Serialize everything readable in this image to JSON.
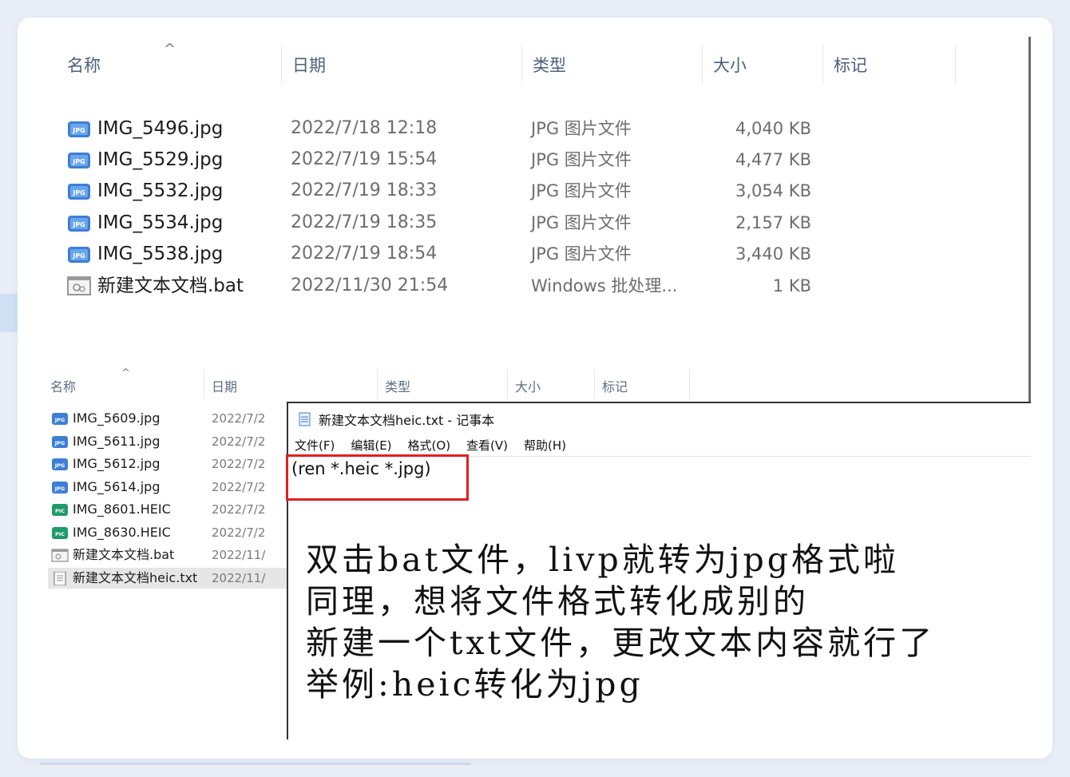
{
  "explorer_main": {
    "columns": {
      "name": "名称",
      "date": "日期",
      "type": "类型",
      "size": "大小",
      "tag": "标记"
    },
    "sort_arrow": "^",
    "files": [
      {
        "icon": "jpg-file-icon",
        "name": "IMG_5496.jpg",
        "date": "2022/7/18 12:18",
        "type": "JPG 图片文件",
        "size": "4,040 KB"
      },
      {
        "icon": "jpg-file-icon",
        "name": "IMG_5529.jpg",
        "date": "2022/7/19 15:54",
        "type": "JPG 图片文件",
        "size": "4,477 KB"
      },
      {
        "icon": "jpg-file-icon",
        "name": "IMG_5532.jpg",
        "date": "2022/7/19 18:33",
        "type": "JPG 图片文件",
        "size": "3,054 KB"
      },
      {
        "icon": "jpg-file-icon",
        "name": "IMG_5534.jpg",
        "date": "2022/7/19 18:35",
        "type": "JPG 图片文件",
        "size": "2,157 KB"
      },
      {
        "icon": "jpg-file-icon",
        "name": "IMG_5538.jpg",
        "date": "2022/7/19 18:54",
        "type": "JPG 图片文件",
        "size": "3,440 KB"
      },
      {
        "icon": "bat-file-icon",
        "name": "新建文本文档.bat",
        "date": "2022/11/30 21:54",
        "type": "Windows 批处理...",
        "size": "1 KB"
      }
    ]
  },
  "explorer_second": {
    "columns": {
      "name": "名称",
      "date": "日期",
      "type": "类型",
      "size": "大小",
      "tag": "标记"
    },
    "sort_arrow": "^",
    "files": [
      {
        "icon": "jpg-file-icon",
        "name": "IMG_5609.jpg",
        "date": "2022/7/2"
      },
      {
        "icon": "jpg-file-icon",
        "name": "IMG_5611.jpg",
        "date": "2022/7/2"
      },
      {
        "icon": "jpg-file-icon",
        "name": "IMG_5612.jpg",
        "date": "2022/7/2"
      },
      {
        "icon": "jpg-file-icon",
        "name": "IMG_5614.jpg",
        "date": "2022/7/2"
      },
      {
        "icon": "heic-file-icon",
        "name": "IMG_8601.HEIC",
        "date": "2022/7/2"
      },
      {
        "icon": "heic-file-icon",
        "name": "IMG_8630.HEIC",
        "date": "2022/7/2"
      },
      {
        "icon": "bat-file-icon",
        "name": "新建文本文档.bat",
        "date": "2022/11/"
      },
      {
        "icon": "txt-file-icon",
        "name": "新建文本文档heic.txt",
        "date": "2022/11/",
        "selected": true
      }
    ]
  },
  "notepad": {
    "title": "新建文本文档heic.txt - 记事本",
    "menu": [
      "文件(F)",
      "编辑(E)",
      "格式(O)",
      "查看(V)",
      "帮助(H)"
    ],
    "content": "(ren *.heic *.jpg)",
    "handwriting": [
      "双击bat文件，livp就转为jpg格式啦",
      "同理，想将文件格式转化成别的",
      "新建一个txt文件，更改文本内容就行了",
      "举例:heic转化为jpg"
    ]
  },
  "colors": {
    "highlight_box": "#e02020",
    "selected_row": "#e6e6e6",
    "page_bg": "#e9eef6"
  }
}
